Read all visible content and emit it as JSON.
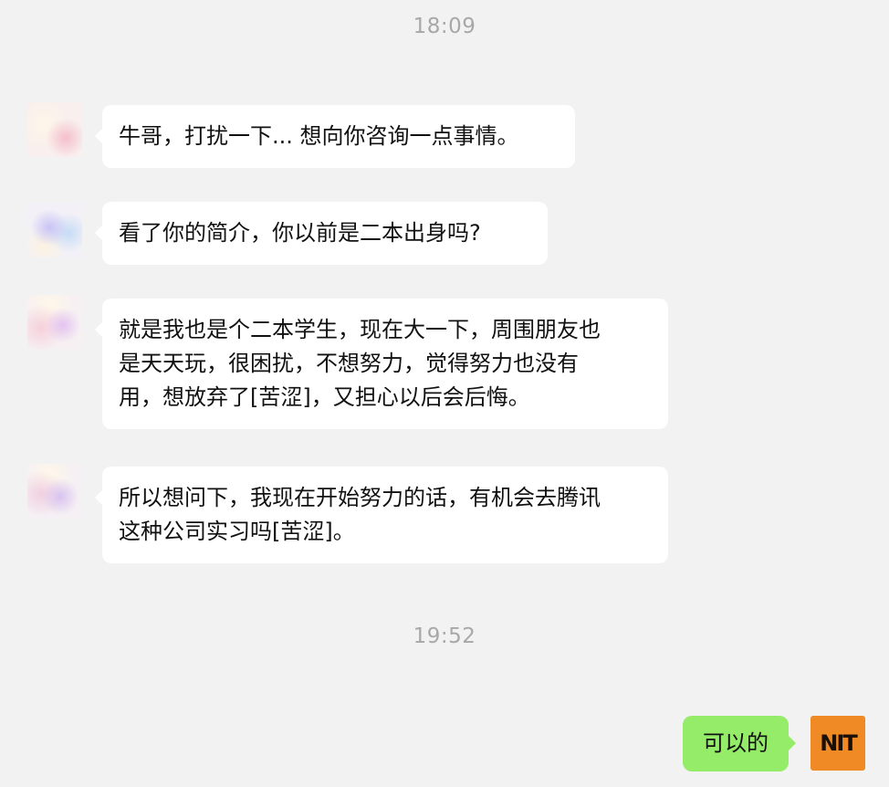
{
  "timestamps": [
    "18:09",
    "19:52"
  ],
  "messages": [
    {
      "sender": "other",
      "lines": [
        "牛哥，打扰一下... 想向你咨询一点事情。"
      ]
    },
    {
      "sender": "other",
      "lines": [
        "看了你的简介，你以前是二本出身吗?"
      ]
    },
    {
      "sender": "other",
      "lines": [
        "就是我也是个二本学生，现在大一下，周围朋友也",
        "是天天玩，很困扰，不想努力，觉得努力也没有",
        "用，想放弃了[苦涩]，又担心以后会后悔。"
      ]
    },
    {
      "sender": "other",
      "lines": [
        "所以想问下，我现在开始努力的话，有机会去腾讯",
        "这种公司实习吗[苦涩]。"
      ]
    },
    {
      "sender": "self",
      "lines": [
        "可以的"
      ]
    }
  ],
  "self_avatar": {
    "logo_text": "NIT",
    "color": "#f08a24"
  },
  "colors": {
    "background": "#f2f2f2",
    "incoming_bubble": "#ffffff",
    "outgoing_bubble": "#95ec69",
    "timestamp": "#a8a8a8"
  }
}
